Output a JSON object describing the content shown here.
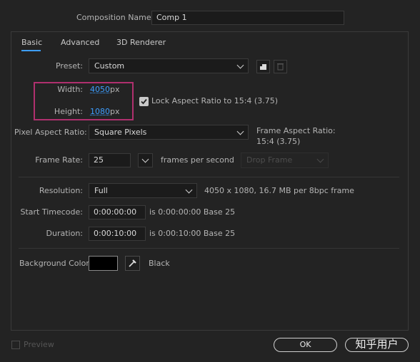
{
  "composition_name": {
    "label": "Composition Name:",
    "value": "Comp 1"
  },
  "tabs": [
    {
      "label": "Basic",
      "active": true
    },
    {
      "label": "Advanced",
      "active": false
    },
    {
      "label": "3D Renderer",
      "active": false
    }
  ],
  "preset": {
    "label": "Preset:",
    "value": "Custom"
  },
  "width": {
    "label": "Width:",
    "value": "4050",
    "unit": "px"
  },
  "height": {
    "label": "Height:",
    "value": "1080",
    "unit": "px"
  },
  "lock_aspect": {
    "label": "Lock Aspect Ratio to 15:4 (3.75)",
    "checked": true
  },
  "pixel_aspect": {
    "label": "Pixel Aspect Ratio:",
    "value": "Square Pixels"
  },
  "frame_aspect": {
    "label": "Frame Aspect Ratio:",
    "value": "15:4 (3.75)"
  },
  "frame_rate": {
    "label": "Frame Rate:",
    "value": "25",
    "unit": "frames per second",
    "drop_frame": "Drop Frame"
  },
  "resolution": {
    "label": "Resolution:",
    "value": "Full",
    "info": "4050 x 1080, 16.7 MB per 8bpc frame"
  },
  "start_timecode": {
    "label": "Start Timecode:",
    "value": "0:00:00:00",
    "info": "is 0:00:00:00  Base 25"
  },
  "duration": {
    "label": "Duration:",
    "value": "0:00:10:00",
    "info": "is 0:00:10:00  Base 25"
  },
  "background_color": {
    "label": "Background Color:",
    "swatch": "#000000",
    "name": "Black"
  },
  "preview": {
    "label": "Preview",
    "checked": false
  },
  "ok_button": {
    "label": "OK"
  },
  "watermark": "知乎用户",
  "colors": {
    "highlight_box": "#b0306e",
    "accent": "#3d9eff"
  }
}
